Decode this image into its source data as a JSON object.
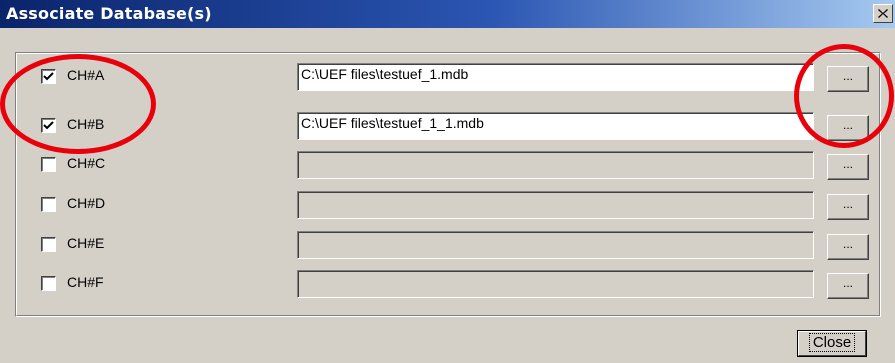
{
  "window": {
    "title": "Associate Database(s)"
  },
  "channels": [
    {
      "label": "CH#A",
      "checked": true,
      "path": "C:\\UEF files\\testuef_1.mdb",
      "browse_label": "..."
    },
    {
      "label": "CH#B",
      "checked": true,
      "path": "C:\\UEF files\\testuef_1_1.mdb",
      "browse_label": "..."
    },
    {
      "label": "CH#C",
      "checked": false,
      "path": "",
      "browse_label": "..."
    },
    {
      "label": "CH#D",
      "checked": false,
      "path": "",
      "browse_label": "..."
    },
    {
      "label": "CH#E",
      "checked": false,
      "path": "",
      "browse_label": "..."
    },
    {
      "label": "CH#F",
      "checked": false,
      "path": "",
      "browse_label": "..."
    }
  ],
  "footer": {
    "close_label": "Close"
  },
  "colors": {
    "face": "#d4d0c8",
    "title_start": "#0a246a",
    "title_end": "#a6caf0",
    "annotation": "#e8000b"
  },
  "icons": {
    "window_close": "close-icon",
    "checked": "checkmark-icon"
  }
}
